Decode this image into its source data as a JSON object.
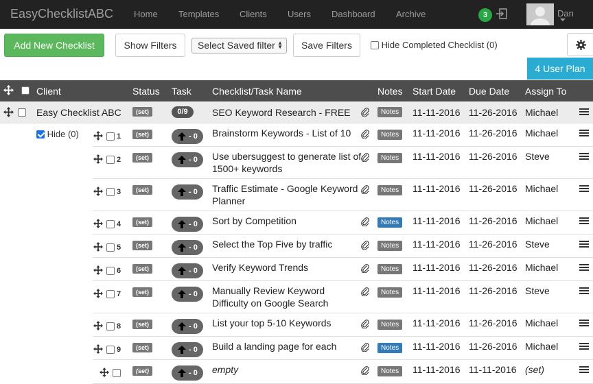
{
  "app": {
    "brand": "EasyChecklistABC"
  },
  "nav": {
    "items": [
      "Home",
      "Templates",
      "Clients",
      "Users",
      "Dashboard",
      "Archive"
    ],
    "notification_count": "3",
    "user_name": "Dan"
  },
  "toolbar": {
    "add_label": "Add New Checklist",
    "show_filters_label": "Show Filters",
    "saved_filter_label": "Select Saved filter",
    "save_filters_label": "Save Filters",
    "hide_completed_label": "Hide Completed Checklist (0)",
    "plan_label": "4 User Plan"
  },
  "table": {
    "headers": {
      "client": "Client",
      "status": "Status",
      "task": "Task",
      "name": "Checklist/Task Name",
      "notes": "Notes",
      "start": "Start Date",
      "due": "Due Date",
      "assign": "Assign To"
    },
    "parent": {
      "client": "Easy Checklist ABC",
      "status": "(set)",
      "task_count": "0/9",
      "name": "SEO Keyword Research - FREE",
      "notes": "Notes",
      "start": "11-11-2016",
      "due": "11-26-2016",
      "assign": "Michael"
    },
    "hide_label": "Hide (0)",
    "rows": [
      {
        "num": "1",
        "status": "(set)",
        "task": "- 0",
        "name1": "Brainstorm Keywords - List of 10",
        "name2": "",
        "notes": "Notes",
        "start": "11-11-2016",
        "due": "11-26-2016",
        "assign": "Michael"
      },
      {
        "num": "2",
        "status": "(set)",
        "task": "- 0",
        "name1": "Use ubersuggest to generate list of",
        "name2": "1500+ keywords",
        "notes": "Notes",
        "start": "11-11-2016",
        "due": "11-26-2016",
        "assign": "Steve"
      },
      {
        "num": "3",
        "status": "(set)",
        "task": "- 0",
        "name1": "Traffic Estimate - Google Keyword",
        "name2": "Planner",
        "notes": "Notes",
        "start": "11-11-2016",
        "due": "11-26-2016",
        "assign": "Michael"
      },
      {
        "num": "4",
        "status": "(set)",
        "task": "- 0",
        "name1": "Sort by Competition",
        "name2": "",
        "notes": "Notes",
        "start": "11-11-2016",
        "due": "11-26-2016",
        "assign": "Michael"
      },
      {
        "num": "5",
        "status": "(set)",
        "task": "- 0",
        "name1": "Select the Top Five by traffic",
        "name2": "",
        "notes": "Notes",
        "start": "11-11-2016",
        "due": "11-26-2016",
        "assign": "Steve"
      },
      {
        "num": "6",
        "status": "(set)",
        "task": "- 0",
        "name1": "Verify Keyword Trends",
        "name2": "",
        "notes": "Notes",
        "start": "11-11-2016",
        "due": "11-26-2016",
        "assign": "Michael"
      },
      {
        "num": "7",
        "status": "(set)",
        "task": "- 0",
        "name1": "Manually Review Keyword",
        "name2": "Difficulty on Google Search",
        "notes": "Notes",
        "start": "11-11-2016",
        "due": "11-26-2016",
        "assign": "Steve"
      },
      {
        "num": "8",
        "status": "(set)",
        "task": "- 0",
        "name1": "List your top 5-10 Keywords",
        "name2": "",
        "notes": "Notes",
        "start": "11-11-2016",
        "due": "11-26-2016",
        "assign": "Michael"
      },
      {
        "num": "9",
        "status": "(set)",
        "task": "- 0",
        "name1": "Build a landing page for each",
        "name2": "",
        "notes": "Notes",
        "start": "11-11-2016",
        "due": "11-26-2016",
        "assign": "Michael"
      },
      {
        "num": "",
        "status": "(set)",
        "task": "- 0",
        "name1": "empty",
        "name2": "",
        "notes": "Notes",
        "start": "11-11-2016",
        "due": "11-11-2016",
        "assign": "(set)"
      }
    ]
  },
  "colors": {
    "navbar": "#222222",
    "success": "#5cb85c",
    "info": "#2aabd2",
    "notes_active": "#337ab7",
    "header": "#4d4d4d"
  }
}
